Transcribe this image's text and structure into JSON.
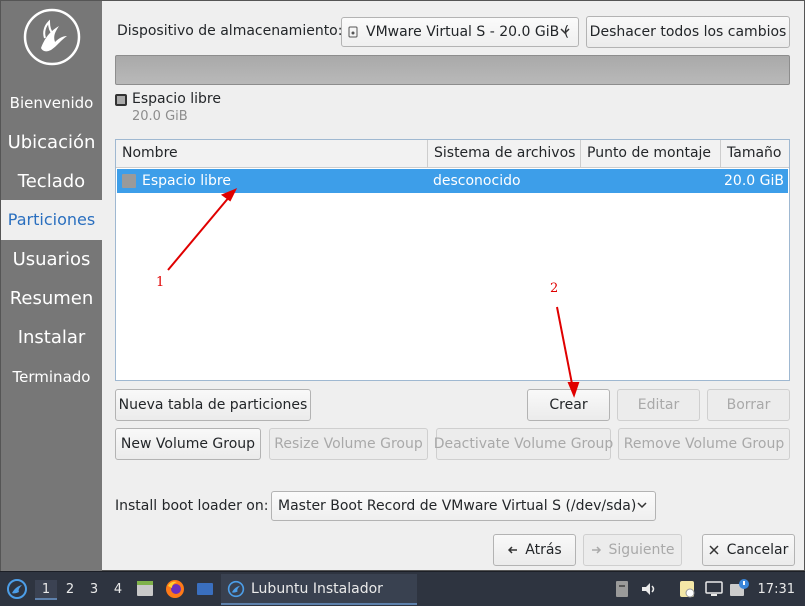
{
  "sidebar": {
    "steps": [
      {
        "label": "Bienvenido"
      },
      {
        "label": "Ubicación"
      },
      {
        "label": "Teclado"
      },
      {
        "label": "Particiones"
      },
      {
        "label": "Usuarios"
      },
      {
        "label": "Resumen"
      },
      {
        "label": "Instalar"
      },
      {
        "label": "Terminado"
      }
    ],
    "active_step": "Particiones"
  },
  "header": {
    "storage_label": "Dispositivo de almacenamiento:",
    "storage_device": "VMware Virtual S - 20.0 GiB (",
    "revert_button": "Deshacer todos los cambios"
  },
  "legend": {
    "label": "Espacio libre",
    "size": "20.0 GiB"
  },
  "partitions": {
    "columns": [
      "Nombre",
      "Sistema de archivos",
      "Punto de montaje",
      "Tamaño"
    ],
    "rows": [
      {
        "name": "Espacio libre",
        "filesystem": "desconocido",
        "mount": "",
        "size": "20.0 GiB",
        "selected": true
      }
    ]
  },
  "actions": {
    "new_table": "Nueva tabla de particiones",
    "create": "Crear",
    "edit": "Editar",
    "delete": "Borrar",
    "new_vg": "New Volume Group",
    "resize_vg": "Resize Volume Group",
    "deactivate_vg": "Deactivate Volume Group",
    "remove_vg": "Remove Volume Group"
  },
  "bootloader": {
    "label": "Install boot loader on:",
    "value": "Master Boot Record de VMware Virtual S (/dev/sda)"
  },
  "nav": {
    "back": "Atrás",
    "next": "Siguiente",
    "cancel": "Cancelar"
  },
  "annotations": {
    "arrow1": "1",
    "arrow2": "2"
  },
  "taskbar": {
    "workspaces": [
      "1",
      "2",
      "3",
      "4"
    ],
    "active_workspace": "1",
    "task_label": "Lubuntu Instalador",
    "clock": "17:31"
  },
  "colors": {
    "sidebar_bg": "#777777",
    "accent": "#3d9ee9",
    "annotation": "#e00000",
    "taskbar_bg": "#2e3440"
  }
}
